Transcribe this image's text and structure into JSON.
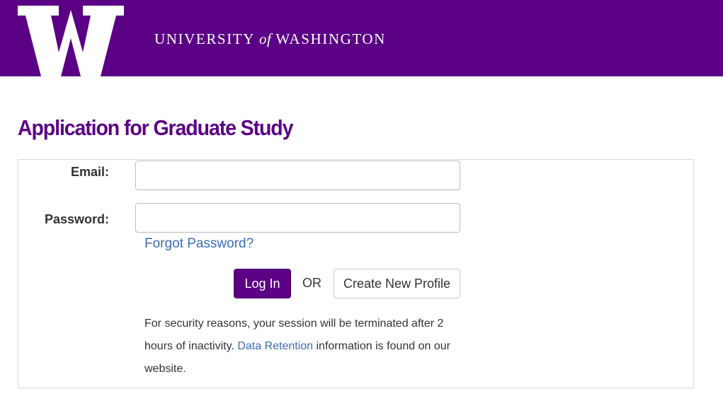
{
  "header": {
    "wordmark_part1": "UNIVERSITY",
    "wordmark_of": "of",
    "wordmark_part2": "WASHINGTON",
    "logo_icon": "uw-w-logo-icon",
    "background_color": "#5b0085"
  },
  "page": {
    "title": "Application for Graduate Study"
  },
  "login_form": {
    "email_label": "Email:",
    "email_value": "",
    "email_placeholder": "",
    "password_label": "Password:",
    "password_value": "",
    "password_placeholder": "",
    "forgot_password_link": "Forgot Password?",
    "login_button": "Log In",
    "or_text": "OR",
    "create_profile_button": "Create New Profile"
  },
  "notice": {
    "text_before_link": "For security reasons, your session will be terminated after 2 hours of inactivity. ",
    "link_text": "Data Retention",
    "text_after_link": " information is found on our website."
  },
  "colors": {
    "brand_purple": "#5b0085",
    "link_blue": "#3b6cb5"
  }
}
